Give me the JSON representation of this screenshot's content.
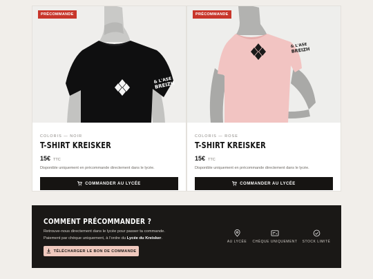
{
  "products": [
    {
      "badge": "PRÉCOMMANDE",
      "coloris": "COLORIS — NOIR",
      "title": "T-SHIRT KREISKER",
      "price": "15€",
      "ttc": "TTC",
      "note": "Disponible uniquement en précommande directement dans le lycée.",
      "button": "COMMANDER AU LYCÉE",
      "shirt_color": "#0f0f10"
    },
    {
      "badge": "PRÉCOMMANDE",
      "coloris": "COLORIS — ROSE",
      "title": "T-SHIRT KREISKER",
      "price": "15€",
      "ttc": "TTC",
      "note": "Disponible uniquement en précommande directement dans le lycée.",
      "button": "COMMANDER AU LYCÉE",
      "shirt_color": "#f2c4c2"
    }
  ],
  "banner": {
    "title": "COMMENT PRÉCOMMANDER ?",
    "line1": "Retrouve-nous directement dans le lycée pour passer ta commande.",
    "line2_prefix": "Paiement par chèque uniquement, à l'ordre du ",
    "line2_bold": "Lycée du Kreisker",
    "line2_suffix": ".",
    "download_button": "TÉLÉCHARGER LE BON DE COMMANDE",
    "features": [
      {
        "icon": "location-pin-icon",
        "label": "AU LYCÉE"
      },
      {
        "icon": "cheque-icon",
        "label": "CHÈQUE UNIQUEMENT"
      },
      {
        "icon": "check-circle-icon",
        "label": "STOCK LIMITÉ"
      }
    ]
  },
  "colors": {
    "badge": "#c8362b",
    "button_dark": "#161412",
    "download_button": "#f0c9be",
    "page_bg": "#f1eeea"
  }
}
